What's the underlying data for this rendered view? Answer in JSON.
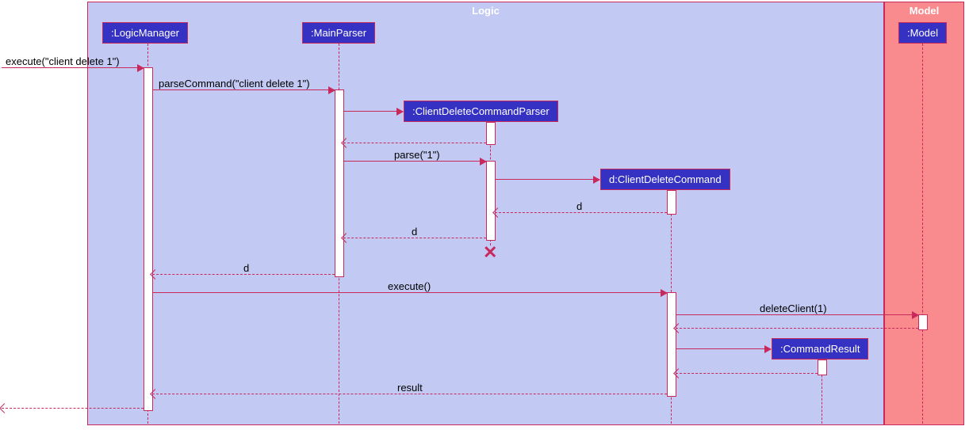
{
  "boxes": {
    "logic": "Logic",
    "model": "Model"
  },
  "participants": {
    "logicManager": ":LogicManager",
    "mainParser": ":MainParser",
    "clientDeleteParser": ":ClientDeleteCommandParser",
    "clientDeleteCommand": "d:ClientDeleteCommand",
    "commandResult": ":CommandResult",
    "model": ":Model"
  },
  "messages": {
    "execute_cmd": "execute(\"client delete 1\")",
    "parseCommand": "parseCommand(\"client delete 1\")",
    "parse": "parse(\"1\")",
    "d1": "d",
    "d2": "d",
    "d3": "d",
    "execute": "execute()",
    "deleteClient": "deleteClient(1)",
    "result": "result"
  },
  "chart_data": {
    "type": "sequence_diagram",
    "boxes": [
      {
        "name": "Logic",
        "participants": [
          "LogicManager",
          "MainParser",
          "ClientDeleteCommandParser",
          "ClientDeleteCommand",
          "CommandResult"
        ]
      },
      {
        "name": "Model",
        "participants": [
          "Model"
        ]
      }
    ],
    "participants": [
      {
        "id": "LogicManager",
        "label": ":LogicManager"
      },
      {
        "id": "MainParser",
        "label": ":MainParser"
      },
      {
        "id": "ClientDeleteCommandParser",
        "label": ":ClientDeleteCommandParser",
        "created_by": "MainParser",
        "destroyed": true
      },
      {
        "id": "ClientDeleteCommand",
        "label": "d:ClientDeleteCommand",
        "created_by": "ClientDeleteCommandParser"
      },
      {
        "id": "CommandResult",
        "label": ":CommandResult",
        "created_by": "ClientDeleteCommand"
      },
      {
        "id": "Model",
        "label": ":Model"
      }
    ],
    "messages": [
      {
        "from": "external",
        "to": "LogicManager",
        "label": "execute(\"client delete 1\")",
        "type": "sync"
      },
      {
        "from": "LogicManager",
        "to": "MainParser",
        "label": "parseCommand(\"client delete 1\")",
        "type": "sync"
      },
      {
        "from": "MainParser",
        "to": "ClientDeleteCommandParser",
        "label": "",
        "type": "create"
      },
      {
        "from": "ClientDeleteCommandParser",
        "to": "MainParser",
        "label": "",
        "type": "return"
      },
      {
        "from": "MainParser",
        "to": "ClientDeleteCommandParser",
        "label": "parse(\"1\")",
        "type": "sync"
      },
      {
        "from": "ClientDeleteCommandParser",
        "to": "ClientDeleteCommand",
        "label": "",
        "type": "create"
      },
      {
        "from": "ClientDeleteCommand",
        "to": "ClientDeleteCommandParser",
        "label": "d",
        "type": "return"
      },
      {
        "from": "ClientDeleteCommandParser",
        "to": "MainParser",
        "label": "d",
        "type": "return"
      },
      {
        "from": "MainParser",
        "to": "LogicManager",
        "label": "d",
        "type": "return"
      },
      {
        "from": "LogicManager",
        "to": "ClientDeleteCommand",
        "label": "execute()",
        "type": "sync"
      },
      {
        "from": "ClientDeleteCommand",
        "to": "Model",
        "label": "deleteClient(1)",
        "type": "sync"
      },
      {
        "from": "Model",
        "to": "ClientDeleteCommand",
        "label": "",
        "type": "return"
      },
      {
        "from": "ClientDeleteCommand",
        "to": "CommandResult",
        "label": "",
        "type": "create"
      },
      {
        "from": "CommandResult",
        "to": "ClientDeleteCommand",
        "label": "",
        "type": "return"
      },
      {
        "from": "ClientDeleteCommand",
        "to": "LogicManager",
        "label": "result",
        "type": "return"
      },
      {
        "from": "LogicManager",
        "to": "external",
        "label": "",
        "type": "return"
      }
    ]
  }
}
